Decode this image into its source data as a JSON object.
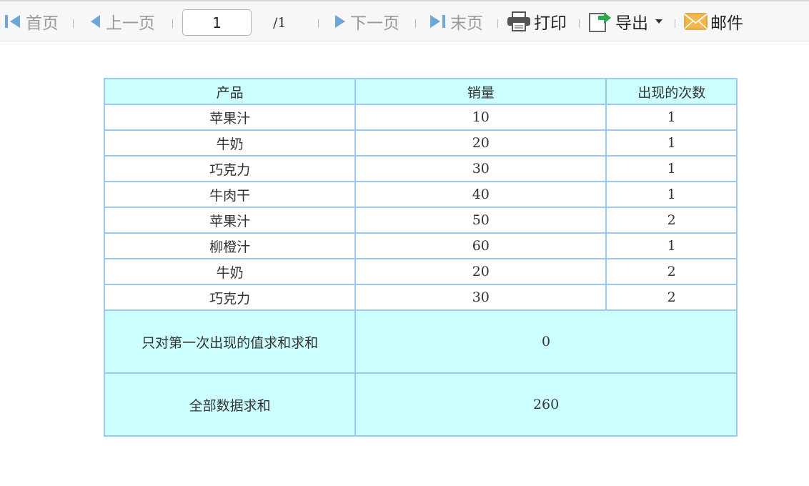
{
  "toolbar": {
    "first_label": "首页",
    "prev_label": "上一页",
    "page_value": "1",
    "page_total": "/1",
    "next_label": "下一页",
    "last_label": "末页",
    "print_label": "打印",
    "export_label": "导出",
    "mail_label": "邮件"
  },
  "table": {
    "columns": [
      "产品",
      "销量",
      "出现的次数"
    ],
    "rows": [
      [
        "苹果汁",
        "10",
        "1"
      ],
      [
        "牛奶",
        "20",
        "1"
      ],
      [
        "巧克力",
        "30",
        "1"
      ],
      [
        "牛肉干",
        "40",
        "1"
      ],
      [
        "苹果汁",
        "50",
        "2"
      ],
      [
        "柳橙汁",
        "60",
        "1"
      ],
      [
        "牛奶",
        "20",
        "2"
      ],
      [
        "巧克力",
        "30",
        "2"
      ]
    ],
    "summary": [
      {
        "label": "只对第一次出现的值求和求和",
        "value": "0"
      },
      {
        "label": "全部数据求和",
        "value": "260"
      }
    ]
  },
  "colors": {
    "header_bg": "#ccffff",
    "border": "#9cc9f2",
    "toolbar_bg": "#f7f7f7"
  }
}
